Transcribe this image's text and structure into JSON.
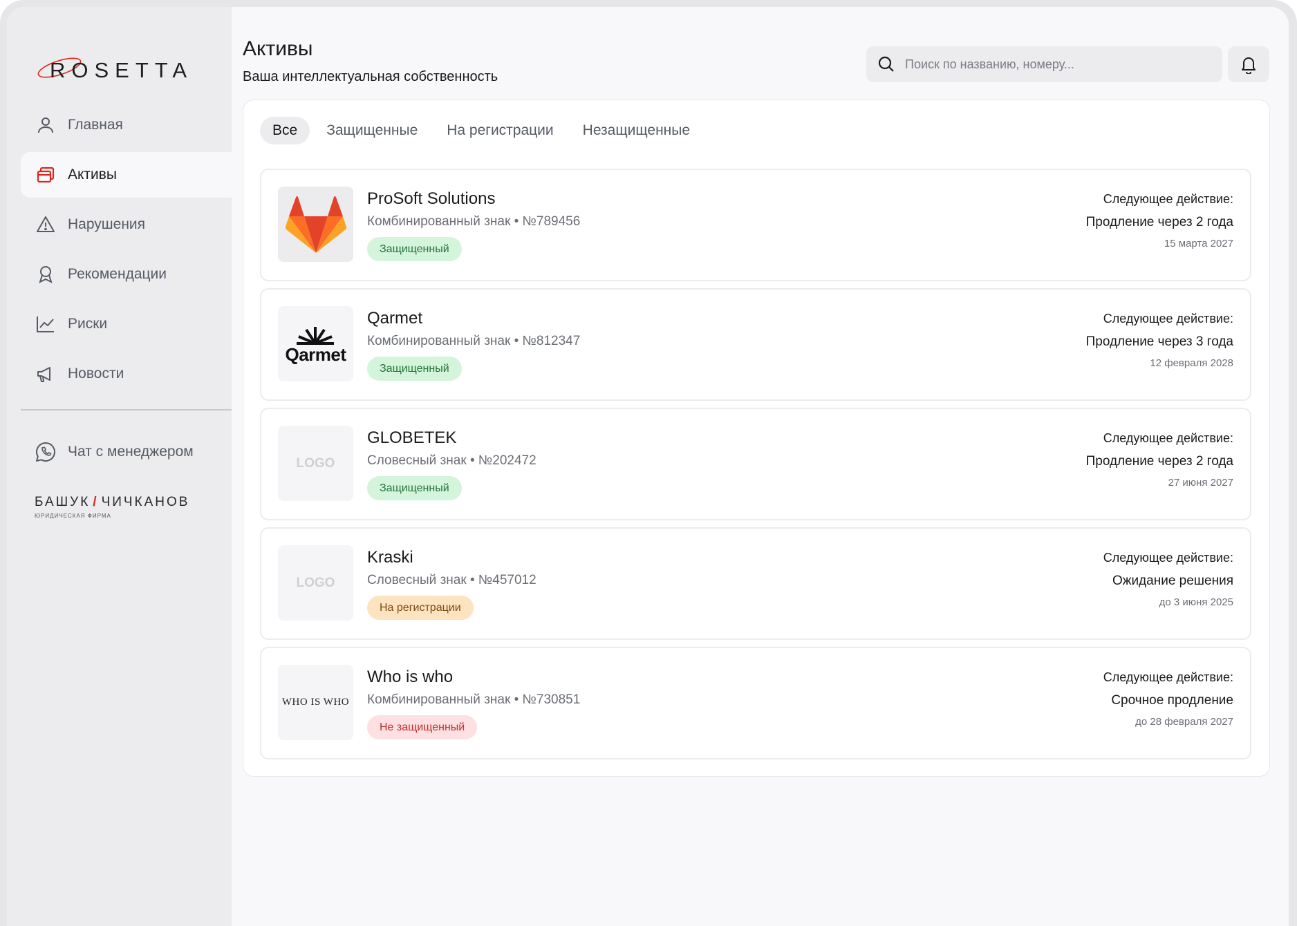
{
  "sidebar": {
    "logo_text": "ROSETTA",
    "items": [
      {
        "label": "Главная",
        "icon": "user-icon"
      },
      {
        "label": "Активы",
        "icon": "assets-icon"
      },
      {
        "label": "Нарушения",
        "icon": "warning-icon"
      },
      {
        "label": "Рекомендации",
        "icon": "award-icon"
      },
      {
        "label": "Риски",
        "icon": "chart-icon"
      },
      {
        "label": "Новости",
        "icon": "megaphone-icon"
      }
    ],
    "active_index": 1,
    "chat_label": "Чат с менеджером",
    "firm": {
      "left": "БАШУК",
      "slash": "/",
      "right": "ЧИЧКАНОВ",
      "sub": "юридическая фирма"
    }
  },
  "header": {
    "title": "Активы",
    "subtitle": "Ваша интеллектуальная собственность",
    "search_placeholder": "Поиск по названию, номеру..."
  },
  "tabs": [
    {
      "label": "Все",
      "active": true
    },
    {
      "label": "Защищенные",
      "active": false
    },
    {
      "label": "На регистрации",
      "active": false
    },
    {
      "label": "Незащищенные",
      "active": false
    }
  ],
  "assets": [
    {
      "name": "ProSoft Solutions",
      "meta": "Комбинированный знак • №789456",
      "status": "Защищенный",
      "status_color": "green",
      "logo": "gitlab-logo",
      "next_label": "Следующее действие:",
      "next_action": "Продление через 2 года",
      "next_date": "15 марта 2027"
    },
    {
      "name": "Qarmet",
      "meta": "Комбинированный знак • №812347",
      "status": "Защищенный",
      "status_color": "green",
      "logo": "qarmet-logo",
      "logo_text": "Qarmet",
      "next_label": "Следующее действие:",
      "next_action": "Продление через 3 года",
      "next_date": "12 февраля 2028"
    },
    {
      "name": "GLOBETEK",
      "meta": "Словесный знак • №202472",
      "status": "Защищенный",
      "status_color": "green",
      "logo": "placeholder",
      "logo_text": "LOGO",
      "next_label": "Следующее действие:",
      "next_action": "Продление через 2 года",
      "next_date": "27 июня 2027"
    },
    {
      "name": "Kraski",
      "meta": "Словесный знак • №457012",
      "status": "На регистрации",
      "status_color": "orange",
      "logo": "placeholder",
      "logo_text": "LOGO",
      "next_label": "Следующее действие:",
      "next_action": "Ожидание решения",
      "next_date": "до 3 июня 2025"
    },
    {
      "name": "Who is who",
      "meta": "Комбинированный знак • №730851",
      "status": "Не защищенный",
      "status_color": "red",
      "logo": "wordmark",
      "logo_text": "WHO IS WHO",
      "next_label": "Следующее действие:",
      "next_action": "Срочное продление",
      "next_date": "до 28 февраля 2027"
    }
  ],
  "colors": {
    "accent": "#d9261c",
    "sidebar_bg": "#ececef",
    "green_badge": "#d4f5dc",
    "orange_badge": "#fde3c0",
    "red_badge": "#fde0e1"
  }
}
